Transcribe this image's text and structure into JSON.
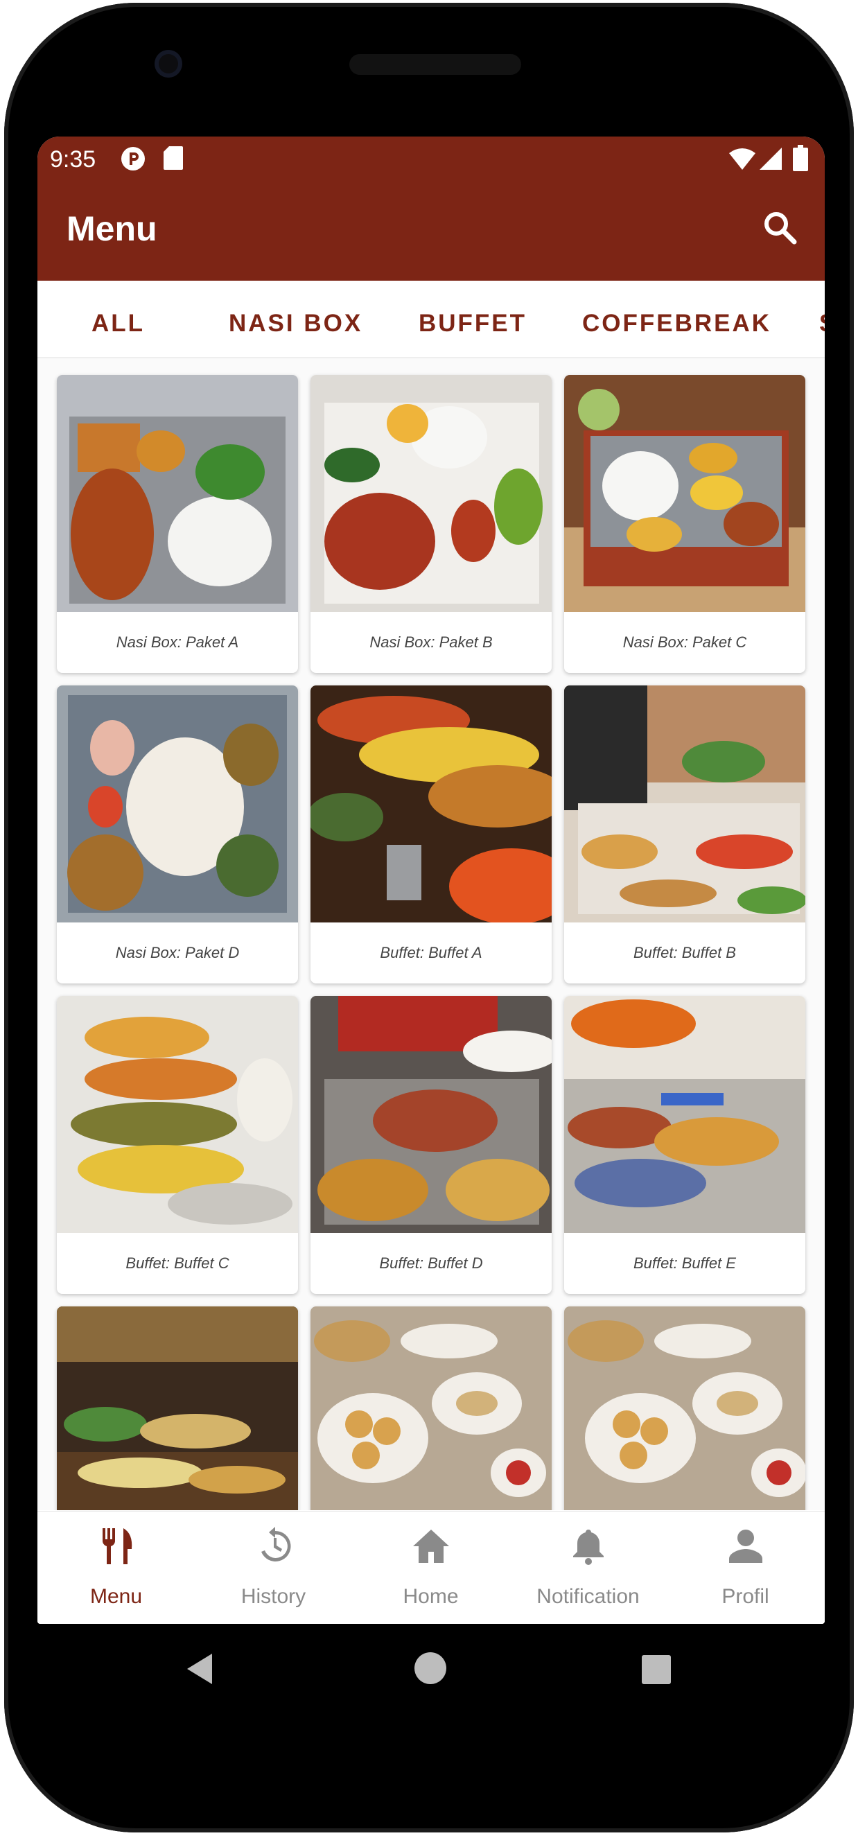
{
  "status_bar": {
    "time": "9:35"
  },
  "app_bar": {
    "title": "Menu"
  },
  "tabs": [
    {
      "label": "ALL"
    },
    {
      "label": "NASI BOX"
    },
    {
      "label": "BUFFET"
    },
    {
      "label": "COFFEBREAK"
    },
    {
      "label": "S"
    }
  ],
  "menu_items": [
    {
      "caption": "Nasi Box: Paket A"
    },
    {
      "caption": "Nasi Box: Paket B"
    },
    {
      "caption": "Nasi Box: Paket C"
    },
    {
      "caption": "Nasi Box: Paket D"
    },
    {
      "caption": "Buffet: Buffet A"
    },
    {
      "caption": "Buffet: Buffet B"
    },
    {
      "caption": "Buffet: Buffet C"
    },
    {
      "caption": "Buffet: Buffet D"
    },
    {
      "caption": "Buffet: Buffet E"
    },
    {
      "caption": ""
    },
    {
      "caption": ""
    },
    {
      "caption": ""
    }
  ],
  "bottom_nav": [
    {
      "label": "Menu",
      "icon": "utensils-icon"
    },
    {
      "label": "History",
      "icon": "history-icon"
    },
    {
      "label": "Home",
      "icon": "home-icon"
    },
    {
      "label": "Notification",
      "icon": "bell-icon"
    },
    {
      "label": "Profil",
      "icon": "person-icon"
    }
  ],
  "colors": {
    "primary": "#7d2515",
    "inactive": "#8a8a8a"
  }
}
